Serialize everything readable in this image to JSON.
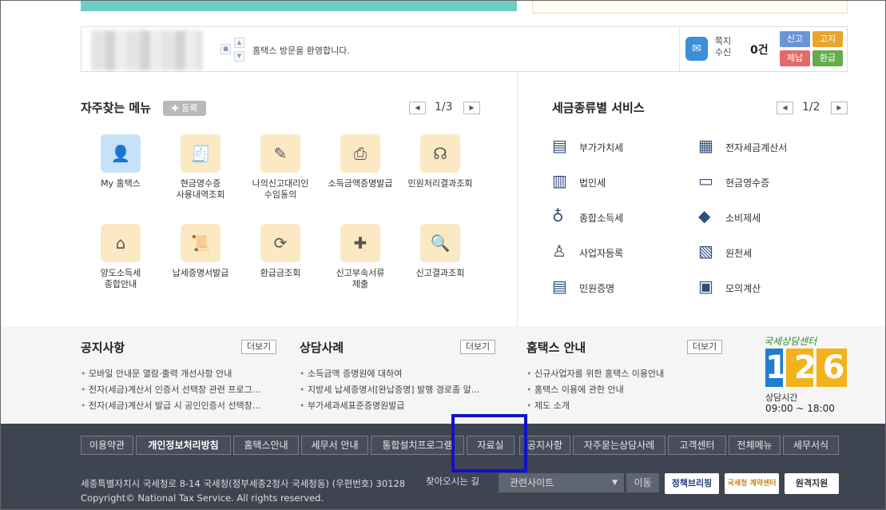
{
  "top": {
    "welcome": "홈택스 방문을 환영합니다.",
    "note_label": "쪽지\n수신",
    "note_count": "0건",
    "quick": [
      {
        "label": "신고",
        "color": "#6b95d6"
      },
      {
        "label": "고지",
        "color": "#e8a62c"
      },
      {
        "label": "체납",
        "color": "#e36a6a"
      },
      {
        "label": "환급",
        "color": "#62ac4c"
      }
    ]
  },
  "favorites": {
    "title": "자주찾는 메뉴",
    "register": "등록",
    "page": "1/3",
    "items": [
      {
        "label": "My 홈택스",
        "icon": "person-icon"
      },
      {
        "label": "현금영수증\n사용내역조회",
        "icon": "receipt-icon"
      },
      {
        "label": "나의신고대리인\n수임동의",
        "icon": "document-pen-icon"
      },
      {
        "label": "소득금액증명발급",
        "icon": "printer-icon"
      },
      {
        "label": "민원처리결과조회",
        "icon": "headset-icon"
      },
      {
        "label": "양도소득세\n종합안내",
        "icon": "house-icon"
      },
      {
        "label": "납세증명서발급",
        "icon": "certificate-icon"
      },
      {
        "label": "환급금조회",
        "icon": "refund-icon"
      },
      {
        "label": "신고부속서류\n제출",
        "icon": "add-document-icon"
      },
      {
        "label": "신고결과조회",
        "icon": "search-document-icon"
      }
    ]
  },
  "tax_services": {
    "title": "세금종류별 서비스",
    "page": "1/2",
    "items": [
      {
        "label": "부가가치세",
        "icon": "vat-icon"
      },
      {
        "label": "전자세금계산서",
        "icon": "calculator-sheet-icon"
      },
      {
        "label": "법인세",
        "icon": "building-icon"
      },
      {
        "label": "현금영수증",
        "icon": "receipt-1000-icon"
      },
      {
        "label": "종합소득세",
        "icon": "money-bag-icon"
      },
      {
        "label": "소비제세",
        "icon": "diamond-icon"
      },
      {
        "label": "사업자등록",
        "icon": "person-icon"
      },
      {
        "label": "원천세",
        "icon": "sal-document-icon"
      },
      {
        "label": "민원증명",
        "icon": "document-icon"
      },
      {
        "label": "모의계산",
        "icon": "calculator-icon"
      }
    ]
  },
  "boards": [
    {
      "title": "공지사항",
      "more": "더보기",
      "items": [
        "모바일 안내문 열람·출력 개선사항 안내",
        "전자(세금)계산서 인증서 선택창 관련 프로그...",
        "전자(세금)계산서 발급 시 공인인증서 선택창..."
      ]
    },
    {
      "title": "상담사례",
      "more": "더보기",
      "items": [
        "소득금액 증명원에 대하여",
        "지방세 납세증명서[완납증명] 발행 경로좀 알...",
        "부가세과세표준증명원발급"
      ]
    },
    {
      "title": "홈택스 안내",
      "more": "더보기",
      "items": [
        "신규사업자를 위한 홈택스 이용안내",
        "홈택스 이용에 관한 안내",
        "제도 소개"
      ]
    }
  ],
  "callcenter": {
    "caption": "국세상담센터",
    "number": "126",
    "hours_label": "상담시간",
    "hours": "09:00 ~ 18:00"
  },
  "footer": {
    "links": [
      "이용약관",
      "개인정보처리방침",
      "홈택스안내",
      "세무서 안내",
      "통합설치프로그램",
      "자료실",
      "공지사항",
      "자주묻는상담사례",
      "고객센터",
      "전체메뉴",
      "세무서식"
    ],
    "address": "세종특별자치시 국세청로 8-14 국세청(정부세종2청사 국세청동) (우편번호) 30128",
    "find": "찾아오시는 길",
    "copyright": "Copyright© National Tax Service. All rights reserved.",
    "related_sites": "관련사이트",
    "move": "이동",
    "badges": [
      "정책브리핑",
      "국세청 계약센터",
      "원격지원"
    ]
  }
}
